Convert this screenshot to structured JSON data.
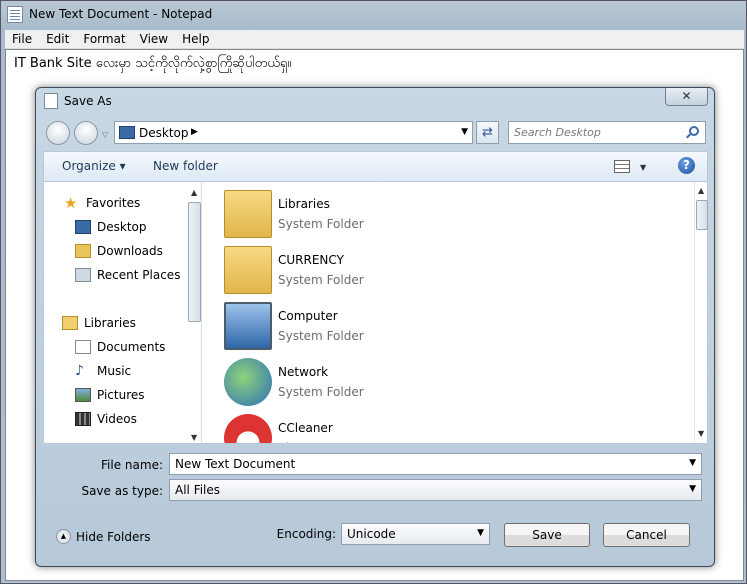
{
  "notepad": {
    "title": "New Text Document - Notepad",
    "menu": [
      "File",
      "Edit",
      "Format",
      "View",
      "Help"
    ],
    "content": "IT Bank Site လေးမှာ သင့်ကိုလိုက်လှဲ့စွာကြိုဆိုပါတယ်ရှ။"
  },
  "dialog": {
    "title": "Save As",
    "close": "✕",
    "address": "Desktop",
    "search_placeholder": "Search Desktop",
    "organize": "Organize ▾",
    "new_folder": "New folder",
    "help": "?",
    "nav": {
      "favorites": "Favorites",
      "fav_items": [
        "Desktop",
        "Downloads",
        "Recent Places"
      ],
      "libraries": "Libraries",
      "lib_items": [
        "Documents",
        "Music",
        "Pictures",
        "Videos"
      ]
    },
    "files": [
      {
        "name": "Libraries",
        "type": "System Folder"
      },
      {
        "name": "CURRENCY",
        "type": "System Folder"
      },
      {
        "name": "Computer",
        "type": "System Folder"
      },
      {
        "name": "Network",
        "type": "System Folder"
      },
      {
        "name": "CCleaner",
        "type": "Shortcut"
      }
    ],
    "file_name_label": "File name:",
    "file_name": "New Text Document",
    "save_type_label": "Save as type:",
    "save_type": "All Files",
    "hide_folders": "Hide Folders",
    "encoding_label": "Encoding:",
    "encoding": "Unicode",
    "save": "Save",
    "cancel": "Cancel"
  }
}
